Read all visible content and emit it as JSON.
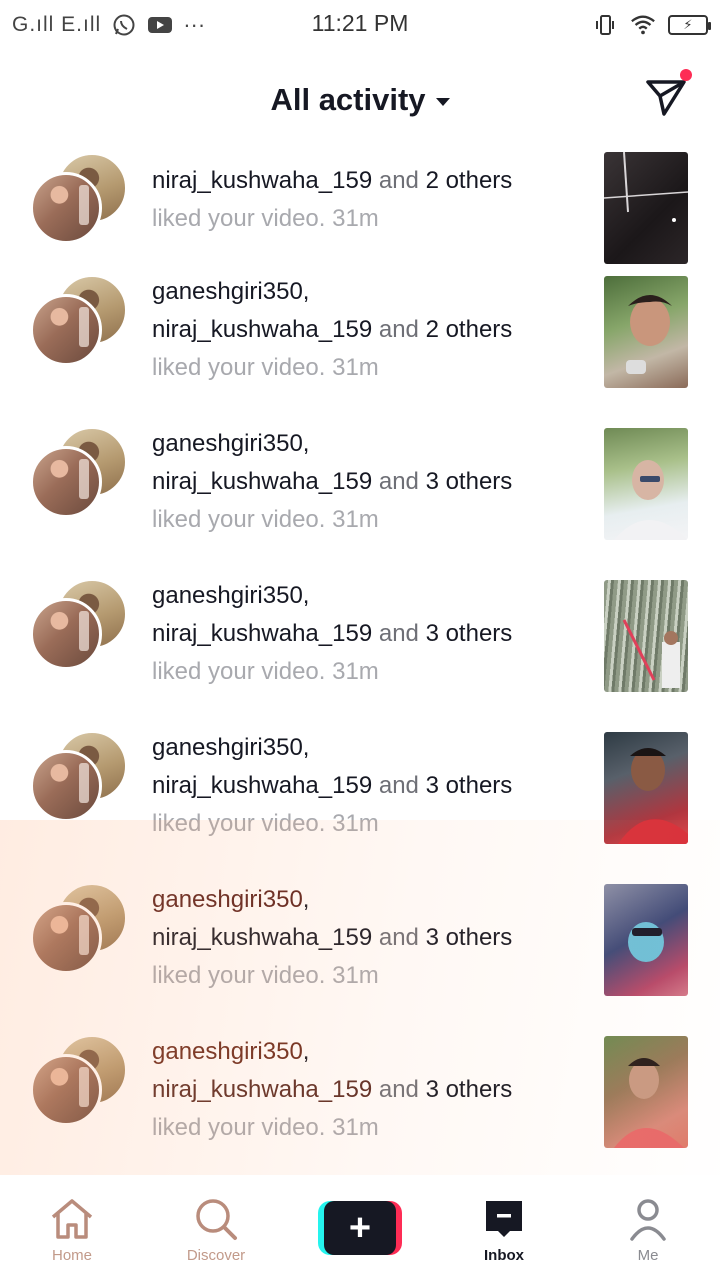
{
  "status_bar": {
    "carrier": "G.ıll E.ıll",
    "time": "11:21 PM",
    "more": "···",
    "battery_label": "⚡"
  },
  "header": {
    "title": "All activity"
  },
  "activity": [
    {
      "line1": "",
      "user2": "niraj_kushwaha_159",
      "and": "and",
      "others": "2 others",
      "action": "liked your video.",
      "time": "31m"
    },
    {
      "line1": "ganeshgiri350",
      "sep": ",",
      "user2": "niraj_kushwaha_159",
      "and": "and",
      "others": "2 others",
      "action": "liked your video.",
      "time": "31m"
    },
    {
      "line1": "ganeshgiri350",
      "sep": ",",
      "user2": "niraj_kushwaha_159",
      "and": "and",
      "others": "3 others",
      "action": "liked your video.",
      "time": "31m"
    },
    {
      "line1": "ganeshgiri350",
      "sep": ",",
      "user2": "niraj_kushwaha_159",
      "and": "and",
      "others": "3 others",
      "action": "liked your video.",
      "time": "31m"
    },
    {
      "line1": "ganeshgiri350",
      "sep": ",",
      "user2": "niraj_kushwaha_159",
      "and": "and",
      "others": "3 others",
      "action": "liked your video.",
      "time": "31m"
    },
    {
      "line1": "ganeshgiri350",
      "sep": ",",
      "user2": "niraj_kushwaha_159",
      "and": "and",
      "others": "3 others",
      "action": "liked your video.",
      "time": "31m"
    },
    {
      "line1": "ganeshgiri350",
      "sep": ",",
      "user2": "niraj_kushwaha_159",
      "and": "and",
      "others": "3 others",
      "action": "liked your video.",
      "time": "31m"
    }
  ],
  "nav": {
    "home": "Home",
    "discover": "Discover",
    "create": "+",
    "inbox": "Inbox",
    "me": "Me"
  },
  "colors": {
    "accent_red": "#fe2c55",
    "accent_cyan": "#25f4ee",
    "text_primary": "#161823",
    "text_secondary": "#a8a9ae"
  }
}
